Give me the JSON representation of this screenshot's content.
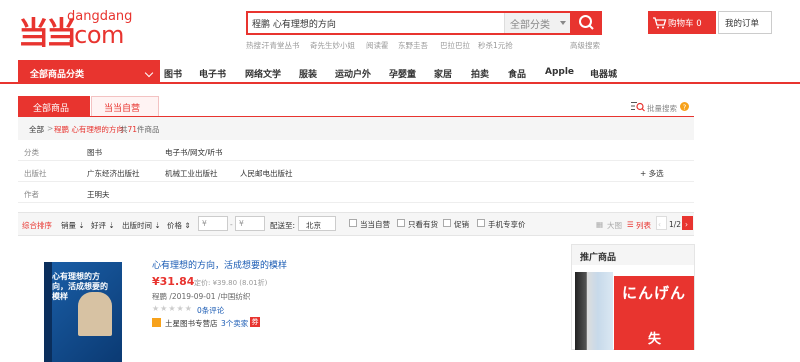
{
  "header": {
    "logo_chars": "当当",
    "logo_small": "dangdang",
    "logo_big": ".com",
    "search_value": "程鹏 心有理想的方向",
    "search_category": "全部分类",
    "hot_words": [
      "热搜:",
      "汗青堂丛书",
      "奇先生妙小姐",
      "阅读霍",
      "东野圭吾",
      "巴拉巴拉",
      "秒杀1元抢"
    ],
    "advanced_search": "高级搜索",
    "cart_label": "购物车",
    "cart_count": "0",
    "orders_label": "我的订单"
  },
  "nav": {
    "all_categories": "全部商品分类",
    "items": [
      "图书",
      "电子书",
      "网络文学",
      "服装",
      "运动户外",
      "孕婴童",
      "家居",
      "拍卖",
      "食品",
      "Apple",
      "电器城"
    ]
  },
  "tabs": {
    "active": "全部商品",
    "second": "当当自营",
    "batch_search": "批量搜索"
  },
  "breadcrumb": {
    "root": "全部",
    "sep": ">",
    "keyword": "程鹏 心有理想的方向",
    "count_prefix": "共",
    "count": "71",
    "count_suffix": "件商品"
  },
  "filters": {
    "category_label": "分类",
    "category_values": [
      "图书",
      "电子书/网文/听书"
    ],
    "publisher_label": "出版社",
    "publisher_values": [
      "广东经济出版社",
      "机械工业出版社",
      "人民邮电出版社"
    ],
    "author_label": "作者",
    "author_values": [
      "王明夫"
    ],
    "more": "多选"
  },
  "sortbar": {
    "items": [
      "综合排序",
      "销量",
      "好评",
      "出版时间",
      "价格"
    ],
    "price_placeholder_low": "¥",
    "price_placeholder_high": "¥",
    "ship_to_label": "配送至:",
    "ship_to_value": "北京",
    "checks": [
      "当当自营",
      "只看有货",
      "促销",
      "手机专享价"
    ],
    "view_large": "大图",
    "view_list": "列表",
    "page": "1/2"
  },
  "product": {
    "title": "心有理想的方向，活成想要的模样",
    "price": "¥31.84",
    "orig_price": "定价: ¥39.80 (8.01折)",
    "meta": "程鹏 /2019-09-01 /中国纺织",
    "stars": "★★★★★",
    "comments": "0条评论",
    "shop": "土星图书专营店",
    "sellers": "3个卖家",
    "book_cover_title": "心有理想的方向，活成想要的模样",
    "badge": "券"
  },
  "promo": {
    "title": "推广商品",
    "book_text": "にんげん",
    "book_text2": "失"
  },
  "colors": {
    "brand": "#e8342f",
    "link": "#1a5bb4"
  }
}
